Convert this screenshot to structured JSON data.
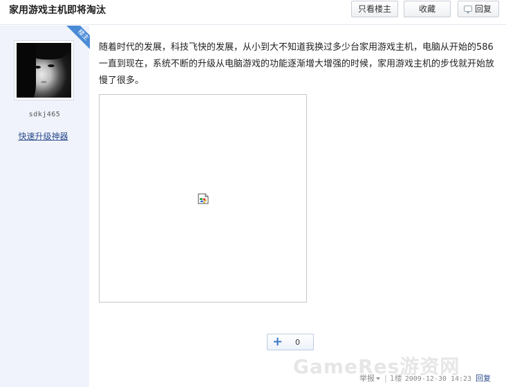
{
  "thread": {
    "title": "家用游戏主机即将淘汰",
    "only_owner_label": "只看楼主",
    "favorite_label": "收藏",
    "reply_label": "回复"
  },
  "author": {
    "username": "sdkj465",
    "upgrade_link": "快速升级神器",
    "badge": "楼主"
  },
  "post": {
    "body": "随着时代的发展，科技飞快的发展，从小到大不知道我换过多少台家用游戏主机，电脑从开始的586一直到现在，系统不断的升级从电脑游戏的功能逐渐增大增强的时候，家用游戏主机的步伐就开始放慢了很多。",
    "image_icon": "broken-image-icon",
    "like_count": "0",
    "report_label": "举报",
    "separator": "|",
    "floor": "1楼",
    "date": "2009-12-30 14:23",
    "reply_label": "回复"
  },
  "watermark": "GameRes游资网",
  "colors": {
    "link": "#2b4c8c",
    "ribbon": "#4a8bd6",
    "sidebar_bg": "#f0f3fb"
  }
}
